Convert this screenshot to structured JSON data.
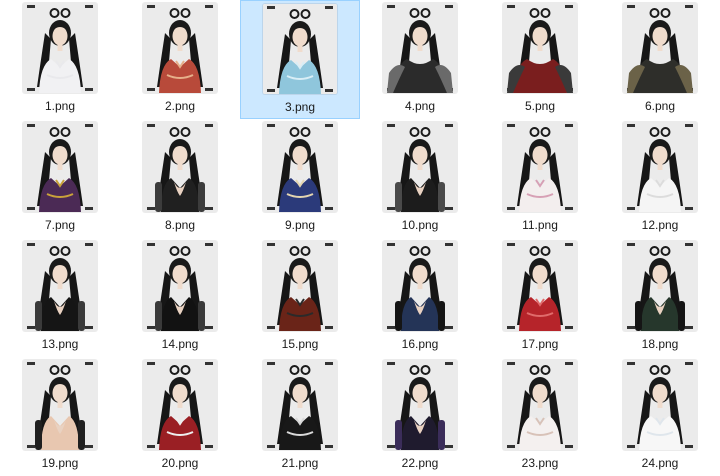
{
  "files": [
    {
      "name": "1.png",
      "selected": false,
      "outfit": "#f1f1f3",
      "accent": "#e9e9ec",
      "style": "dress"
    },
    {
      "name": "2.png",
      "selected": false,
      "outfit": "#b84a3a",
      "accent": "#e6b08a",
      "style": "dress"
    },
    {
      "name": "3.png",
      "selected": true,
      "outfit": "#8fc6dc",
      "accent": "#d9eef6",
      "style": "dress"
    },
    {
      "name": "4.png",
      "selected": false,
      "outfit": "#2b2b2b",
      "accent": "#6a6a6a",
      "style": "fur"
    },
    {
      "name": "5.png",
      "selected": false,
      "outfit": "#7a1e1e",
      "accent": "#3a3a3a",
      "style": "fur"
    },
    {
      "name": "6.png",
      "selected": false,
      "outfit": "#2e2e2a",
      "accent": "#6b6248",
      "style": "fur"
    },
    {
      "name": "7.png",
      "selected": false,
      "outfit": "#4b2a55",
      "accent": "#c9a23a",
      "style": "dress"
    },
    {
      "name": "8.png",
      "selected": false,
      "outfit": "#202020",
      "accent": "#3c3c3c",
      "style": "halter"
    },
    {
      "name": "9.png",
      "selected": false,
      "outfit": "#2b3a7a",
      "accent": "#e3d5b0",
      "style": "dress"
    },
    {
      "name": "10.png",
      "selected": false,
      "outfit": "#1c1c1c",
      "accent": "#4a4a4a",
      "style": "halter"
    },
    {
      "name": "11.png",
      "selected": false,
      "outfit": "#f3eeee",
      "accent": "#d7a0b5",
      "style": "dress"
    },
    {
      "name": "12.png",
      "selected": false,
      "outfit": "#f5f5f5",
      "accent": "#dcdcdc",
      "style": "dress"
    },
    {
      "name": "13.png",
      "selected": false,
      "outfit": "#151515",
      "accent": "#3a3a3a",
      "style": "halter"
    },
    {
      "name": "14.png",
      "selected": false,
      "outfit": "#121212",
      "accent": "#3a3a3a",
      "style": "halter"
    },
    {
      "name": "15.png",
      "selected": false,
      "outfit": "#6a2418",
      "accent": "#2a2a2a",
      "style": "dress"
    },
    {
      "name": "16.png",
      "selected": false,
      "outfit": "#243457",
      "accent": "#151515",
      "style": "halter"
    },
    {
      "name": "17.png",
      "selected": false,
      "outfit": "#b6242a",
      "accent": "#e06b6b",
      "style": "dress"
    },
    {
      "name": "18.png",
      "selected": false,
      "outfit": "#26372c",
      "accent": "#151515",
      "style": "halter"
    },
    {
      "name": "19.png",
      "selected": false,
      "outfit": "#e8c7b0",
      "accent": "#202020",
      "style": "halter"
    },
    {
      "name": "20.png",
      "selected": false,
      "outfit": "#9a1f24",
      "accent": "#eeeeee",
      "style": "dress"
    },
    {
      "name": "21.png",
      "selected": false,
      "outfit": "#181818",
      "accent": "#d9d9d9",
      "style": "dress"
    },
    {
      "name": "22.png",
      "selected": false,
      "outfit": "#1f1b2e",
      "accent": "#3b2d5a",
      "style": "halter"
    },
    {
      "name": "23.png",
      "selected": false,
      "outfit": "#f4f0ef",
      "accent": "#d8c2b8",
      "style": "dress"
    },
    {
      "name": "24.png",
      "selected": false,
      "outfit": "#f7f7f7",
      "accent": "#dfe6ec",
      "style": "dress"
    }
  ]
}
